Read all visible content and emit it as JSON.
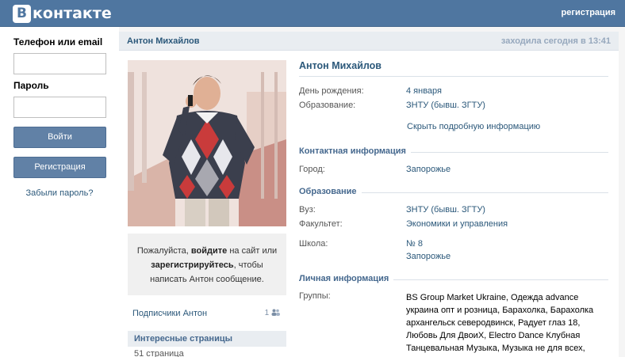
{
  "header": {
    "logo_letter": "В",
    "logo_text": "контакте",
    "register_link": "регистрация"
  },
  "login": {
    "phone_label": "Телефон или email",
    "password_label": "Пароль",
    "login_button": "Войти",
    "register_button": "Регистрация",
    "forgot_link": "Забыли пароль?"
  },
  "profile": {
    "head_name": "Антон Михайлов",
    "last_seen": "заходила сегодня в 13:41",
    "name": "Антон Михайлов",
    "birthday_label": "День рождения:",
    "birthday_value": "4 января",
    "education_label": "Образование:",
    "education_value": "ЗНТУ (бывш. ЗГТУ)",
    "hide_info_link": "Скрыть подробную информацию"
  },
  "sections": {
    "contact_title": "Контактная информация",
    "city_label": "Город:",
    "city_value": "Запорожье",
    "education_title": "Образование",
    "university_label": "Вуз:",
    "university_value": "ЗНТУ (бывш. ЗГТУ)",
    "faculty_label": "Факультет:",
    "faculty_value": "Экономики и управления",
    "school_label": "Школа:",
    "school_value": "№ 8",
    "school_city": "Запорожье",
    "personal_title": "Личная информация",
    "groups_label": "Группы:",
    "groups_value": "BS Group Market Ukraine, Одежда advance украина опт и розница, Барахолка, Барахолка архангельск северодвинск, Радует глаз 18, Любовь Для ДвоиХ, Electro Dance Клубная Танцевальная Музыка, Музыка не для всех, Экстрасенс Ясновидящая Украина, Статусы со"
  },
  "message_box": {
    "text_1": "Пожалуйста, ",
    "login_word": "войдите",
    "text_2": " на сайт или",
    "register_word": "зарегистрируйтесь",
    "text_3": ", чтобы",
    "text_4": "написать Антон сообщение."
  },
  "subscribers": {
    "label": "Подписчики Антон",
    "count": "1"
  },
  "interesting": {
    "title": "Интересные страницы",
    "count_text": "51 страница"
  },
  "colors": {
    "header_bg": "#4f76a0",
    "link": "#2b587a",
    "button_bg": "#6181a6"
  }
}
